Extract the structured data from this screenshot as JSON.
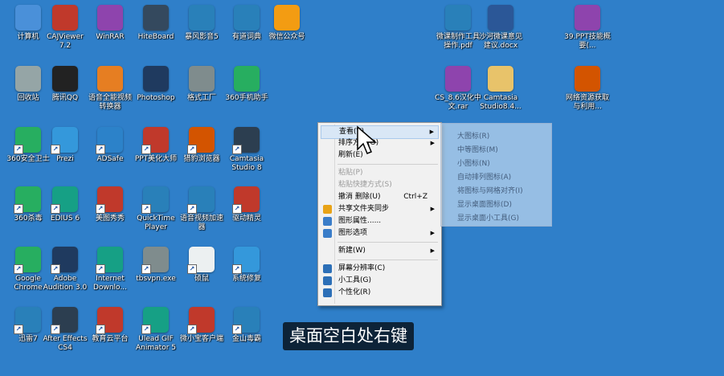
{
  "desktop_icons": [
    {
      "label": "计算机",
      "icon": "computer-icon",
      "color": "#4a90d9"
    },
    {
      "label": "CAJViewer 7.2",
      "icon": "cajviewer-icon",
      "color": "#c0392b"
    },
    {
      "label": "WinRAR",
      "icon": "winrar-icon",
      "color": "#8e44ad"
    },
    {
      "label": "HiteBoard",
      "icon": "hiteboard-icon",
      "color": "#34495e"
    },
    {
      "label": "暴风影音5",
      "icon": "storm-player-icon",
      "color": "#2980b9"
    },
    {
      "label": "有道词典",
      "icon": "youdao-icon",
      "color": "#2980b9"
    },
    {
      "label": "微信公众号",
      "icon": "wechat-icon",
      "color": "#f39c12"
    },
    {
      "label": "回收站",
      "icon": "recycle-bin-icon",
      "color": "#95a5a6"
    },
    {
      "label": "腾讯QQ",
      "icon": "qq-icon",
      "color": "#222222"
    },
    {
      "label": "语音全能视频转换器",
      "icon": "video-converter-icon",
      "color": "#e67e22"
    },
    {
      "label": "Photoshop",
      "icon": "photoshop-icon",
      "color": "#1f3a5f"
    },
    {
      "label": "格式工厂",
      "icon": "format-factory-icon",
      "color": "#7f8c8d"
    },
    {
      "label": "360手机助手",
      "icon": "360-phone-icon",
      "color": "#27ae60"
    },
    {
      "label": "360安全卫士",
      "icon": "360-safe-icon",
      "color": "#27ae60"
    },
    {
      "label": "Prezi",
      "icon": "prezi-icon",
      "color": "#3498db"
    },
    {
      "label": "ADSafe",
      "icon": "adsafe-icon",
      "color": "#2c82c9"
    },
    {
      "label": "PPT美化大师",
      "icon": "ppt-master-icon",
      "color": "#c0392b"
    },
    {
      "label": "猎豹浏览器",
      "icon": "cheetah-browser-icon",
      "color": "#d35400"
    },
    {
      "label": "Camtasia Studio 8",
      "icon": "camtasia-icon",
      "color": "#2c3e50"
    },
    {
      "label": "360杀毒",
      "icon": "360-antivirus-icon",
      "color": "#27ae60"
    },
    {
      "label": "EDIUS 6",
      "icon": "edius-icon",
      "color": "#16a085"
    },
    {
      "label": "美图秀秀",
      "icon": "meitu-icon",
      "color": "#c0392b"
    },
    {
      "label": "QuickTime Player",
      "icon": "quicktime-icon",
      "color": "#2980b9"
    },
    {
      "label": "语音视频加速器",
      "icon": "video-accelerator-icon",
      "color": "#2980b9"
    },
    {
      "label": "驱动精灵",
      "icon": "driver-genius-icon",
      "color": "#c0392b"
    },
    {
      "label": "Google Chrome",
      "icon": "chrome-icon",
      "color": "#27ae60"
    },
    {
      "label": "Adobe Audition 3.0",
      "icon": "audition-icon",
      "color": "#1f3a5f"
    },
    {
      "label": "Internet Downlo...",
      "icon": "idm-icon",
      "color": "#16a085"
    },
    {
      "label": "tbsvpn.exe",
      "icon": "tbsvpn-icon",
      "color": "#7f8c8d"
    },
    {
      "label": "硕鼠",
      "icon": "shuoshu-icon",
      "color": "#ecf0f1"
    },
    {
      "label": "系统修复",
      "icon": "system-repair-icon",
      "color": "#3498db"
    },
    {
      "label": "迅雷7",
      "icon": "xunlei-icon",
      "color": "#2980b9"
    },
    {
      "label": "After Effects CS4",
      "icon": "after-effects-icon",
      "color": "#2c3e50"
    },
    {
      "label": "教育云平台",
      "icon": "edu-cloud-icon",
      "color": "#c0392b"
    },
    {
      "label": "Ulead GIF Animator 5",
      "icon": "ulead-gif-icon",
      "color": "#16a085"
    },
    {
      "label": "微小宝客户端",
      "icon": "weixiaobao-icon",
      "color": "#c0392b"
    },
    {
      "label": "金山毒霸",
      "icon": "kingsoft-antivirus-icon",
      "color": "#2980b9"
    },
    {
      "label": "微课制作工具操作.pdf",
      "icon": "pdf-file-icon",
      "color": "#2980b9"
    },
    {
      "label": "沙河微课意见建议.docx",
      "icon": "word-file-icon",
      "color": "#2b5797"
    },
    {
      "label": "39.PPT技能概要(...",
      "icon": "rar-file-icon",
      "color": "#8e44ad"
    },
    {
      "label": "CS_8.6汉化中文.rar",
      "icon": "rar-file-icon",
      "color": "#8e44ad"
    },
    {
      "label": "Camtasia Studio8.4...",
      "icon": "folder-icon",
      "color": "#e8c36a"
    },
    {
      "label": "网络资源获取与利用...",
      "icon": "ppt-file-icon",
      "color": "#d35400"
    }
  ],
  "context_menu": {
    "items": [
      {
        "label": "查看(V)",
        "key": "",
        "submenu": true,
        "disabled": false,
        "highlight": true,
        "icon": ""
      },
      {
        "label": "排序方式(O)",
        "key": "",
        "submenu": true,
        "disabled": false,
        "highlight": false,
        "icon": ""
      },
      {
        "label": "刷新(E)",
        "key": "",
        "submenu": false,
        "disabled": false,
        "highlight": false,
        "icon": ""
      },
      {
        "sep": true
      },
      {
        "label": "粘贴(P)",
        "key": "",
        "submenu": false,
        "disabled": true,
        "highlight": false,
        "icon": ""
      },
      {
        "label": "粘贴快捷方式(S)",
        "key": "",
        "submenu": false,
        "disabled": true,
        "highlight": false,
        "icon": ""
      },
      {
        "label": "撤消 删除(U)",
        "key": "Ctrl+Z",
        "submenu": false,
        "disabled": false,
        "highlight": false,
        "icon": ""
      },
      {
        "label": "共享文件夹同步",
        "key": "",
        "submenu": true,
        "disabled": false,
        "highlight": false,
        "icon": "#e8a317"
      },
      {
        "label": "图形属性......",
        "key": "",
        "submenu": false,
        "disabled": false,
        "highlight": false,
        "icon": "#3a7dc9"
      },
      {
        "label": "图形选项",
        "key": "",
        "submenu": true,
        "disabled": false,
        "highlight": false,
        "icon": "#3a7dc9"
      },
      {
        "sep": true
      },
      {
        "label": "新建(W)",
        "key": "",
        "submenu": true,
        "disabled": false,
        "highlight": false,
        "icon": ""
      },
      {
        "sep": true
      },
      {
        "label": "屏幕分辨率(C)",
        "key": "",
        "submenu": false,
        "disabled": false,
        "highlight": false,
        "icon": "#2c6fb7"
      },
      {
        "label": "小工具(G)",
        "key": "",
        "submenu": false,
        "disabled": false,
        "highlight": false,
        "icon": "#2c6fb7"
      },
      {
        "label": "个性化(R)",
        "key": "",
        "submenu": false,
        "disabled": false,
        "highlight": false,
        "icon": "#2c6fb7"
      }
    ]
  },
  "view_submenu_ghost": [
    "大图标(R)",
    "中等图标(M)",
    "小图标(N)",
    "自动排列图标(A)",
    "将图标与网格对齐(I)",
    "显示桌面图标(D)",
    "显示桌面小工具(G)"
  ],
  "caption": "桌面空白处右键"
}
